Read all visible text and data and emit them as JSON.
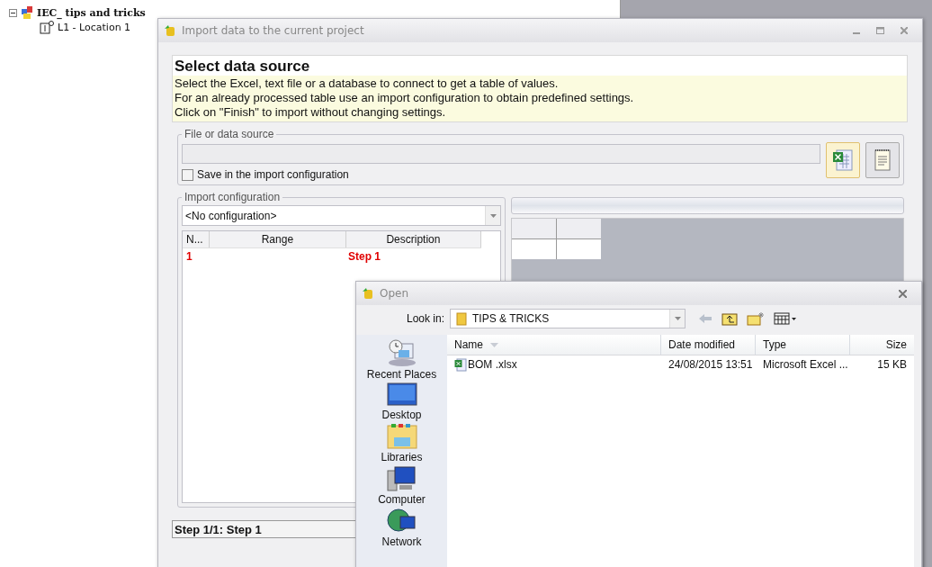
{
  "tree": [
    {
      "label": "IEC_ tips and tricks",
      "expanded": true,
      "children": [
        {
          "label": "L1 - Location 1"
        }
      ]
    }
  ],
  "import_window": {
    "title": "Import data to the current project",
    "heading": "Select data source",
    "instructions": [
      "Select the Excel, text file or a database to connect to get a table of values.",
      "For an already processed table use an import configuration to obtain predefined settings.",
      "Click on \"Finish\" to import without changing settings."
    ],
    "file_group": {
      "legend": "File or data source",
      "save_option": {
        "label": "Save in the import configuration",
        "checked": false
      }
    },
    "config_group": {
      "legend": "Import configuration",
      "configuration": "<No configuration>",
      "columns": [
        "N...",
        "Range",
        "Description"
      ],
      "rows": [
        {
          "number": "1",
          "description": "Step 1"
        }
      ]
    },
    "status": "Step 1/1: Step 1"
  },
  "open_dialog": {
    "title": "Open",
    "look_in_label": "Look in:",
    "look_in": "TIPS & TRICKS",
    "places": [
      {
        "kind": "recent",
        "label": "Recent Places"
      },
      {
        "kind": "desktop",
        "label": "Desktop"
      },
      {
        "kind": "libraries",
        "label": "Libraries"
      },
      {
        "kind": "computer",
        "label": "Computer"
      },
      {
        "kind": "network",
        "label": "Network"
      }
    ],
    "columns": [
      "Name",
      "Date modified",
      "Type",
      "Size"
    ],
    "files": [
      {
        "name": "BOM .xlsx",
        "date_modified": "24/08/2015 13:51",
        "type": "Microsoft Excel ...",
        "size": "15 KB"
      }
    ]
  }
}
